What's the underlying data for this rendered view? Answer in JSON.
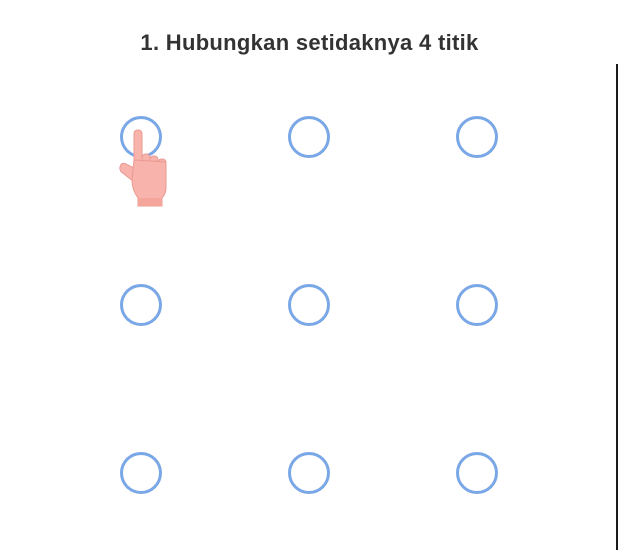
{
  "instruction": {
    "title": "1. Hubungkan setidaknya 4 titik"
  },
  "pattern_grid": {
    "rows": 3,
    "cols": 3,
    "dot_color": "#7aa7e6",
    "dots": [
      {
        "id": "1"
      },
      {
        "id": "2"
      },
      {
        "id": "3"
      },
      {
        "id": "4"
      },
      {
        "id": "5"
      },
      {
        "id": "6"
      },
      {
        "id": "7"
      },
      {
        "id": "8"
      },
      {
        "id": "9"
      }
    ]
  },
  "hint": {
    "icon": "pointing-hand-icon",
    "color": "#f8b4ac"
  }
}
